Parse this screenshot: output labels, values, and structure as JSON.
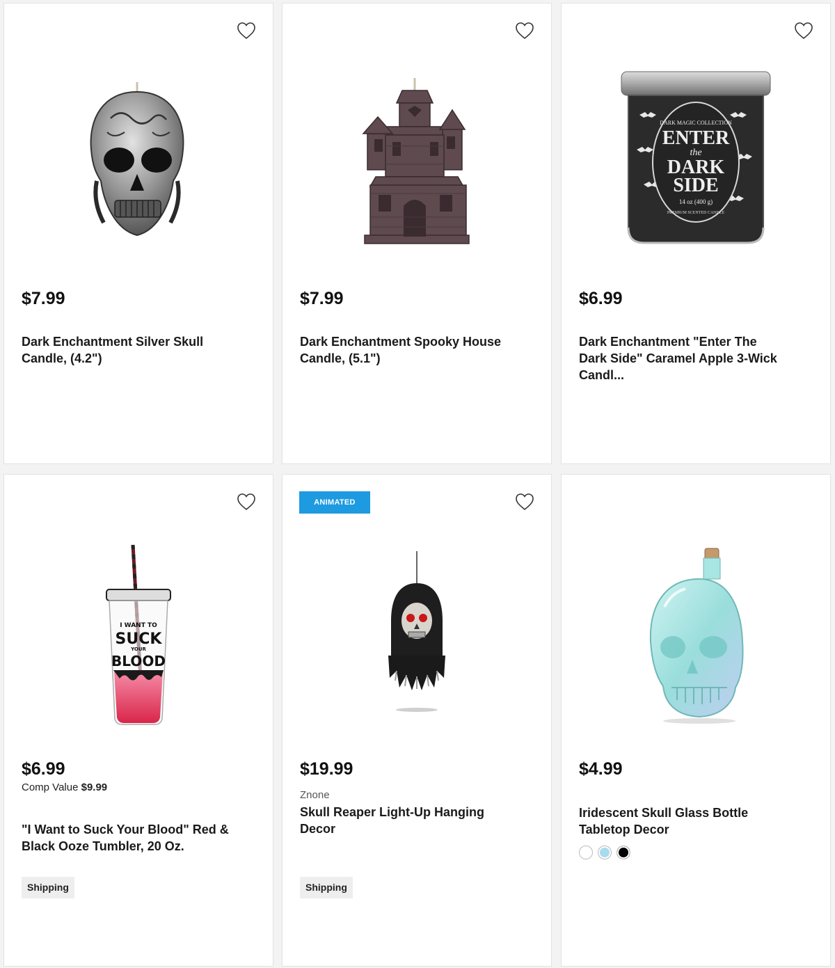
{
  "products": [
    {
      "price": "$7.99",
      "name": "Dark Enchantment Silver Skull Candle, (4.2\")",
      "image": "silver-skull-candle"
    },
    {
      "price": "$7.99",
      "name": "Dark Enchantment Spooky House Candle, (5.1\")",
      "image": "spooky-house-candle"
    },
    {
      "price": "$6.99",
      "name": "Dark Enchantment \"Enter The Dark Side\" Caramel Apple 3-Wick Candl...",
      "image": "enter-the-dark-side-candle",
      "label": {
        "top": "DARK MAGIC COLLECTION",
        "line1": "ENTER",
        "line2": "the",
        "line3": "DARK",
        "line4": "SIDE",
        "weight": "14 oz (400 g)",
        "bottom": "PREMIUM SCENTED CANDLE"
      }
    },
    {
      "price": "$6.99",
      "comp_label": "Comp Value",
      "comp_value": "$9.99",
      "name": "\"I Want to Suck Your Blood\" Red & Black Ooze Tumbler, 20 Oz.",
      "shipping": "Shipping",
      "image": "blood-tumbler",
      "cup_text": {
        "line1": "I WANT TO",
        "line2": "SUCK",
        "line3": "YOUR",
        "line4": "BLOOD"
      }
    },
    {
      "badge": "ANIMATED",
      "price": "$19.99",
      "brand": "Znone",
      "name": "Skull Reaper Light-Up Hanging Decor",
      "shipping": "Shipping",
      "image": "skull-reaper"
    },
    {
      "price": "$4.99",
      "name": "Iridescent Skull Glass Bottle Tabletop Decor",
      "image": "iridescent-skull-bottle",
      "swatches": [
        "#ffffff",
        "#a8dcec",
        "#000000"
      ]
    }
  ],
  "icons": {
    "wishlist": "heart-outline-icon"
  },
  "colors": {
    "badge": "#1e9ae0",
    "shipping_bg": "#eeeeee",
    "page_bg": "#f3f3f3"
  }
}
